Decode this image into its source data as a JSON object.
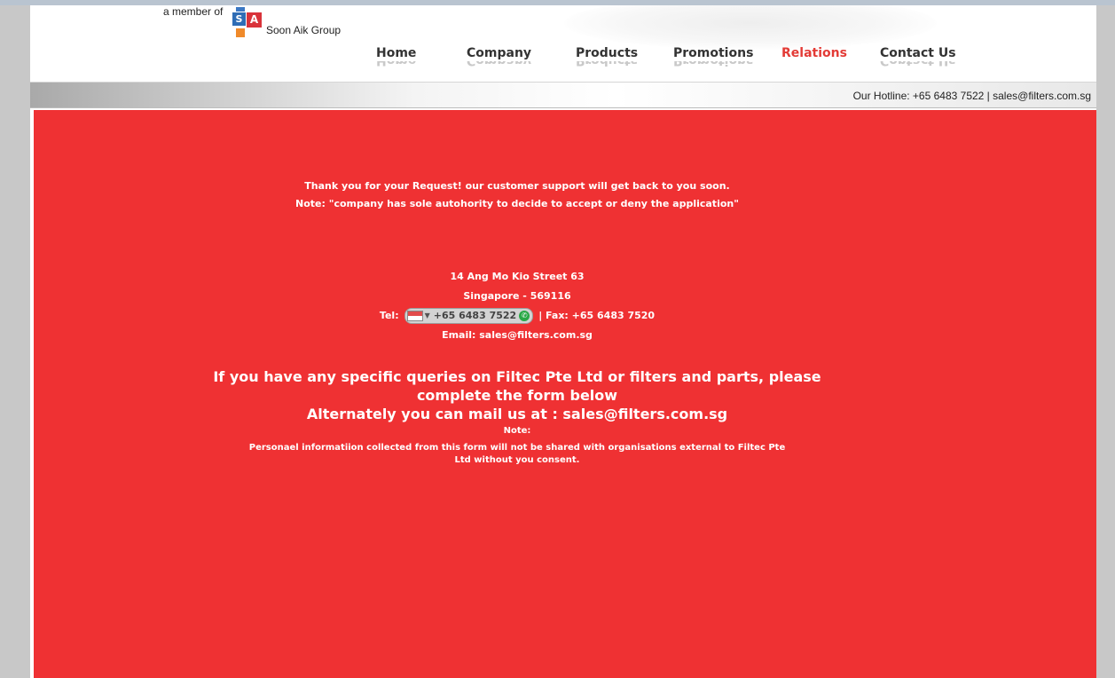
{
  "header": {
    "member_text": "a member of",
    "logo_letters": [
      "S",
      "A"
    ],
    "group_name": "Soon Aik Group"
  },
  "nav": {
    "items": [
      {
        "label": "Home"
      },
      {
        "label": "Company"
      },
      {
        "label": "Products"
      },
      {
        "label": "Promotions"
      },
      {
        "label": "Relations",
        "active": true
      },
      {
        "label": "Contact Us"
      }
    ]
  },
  "hotline": {
    "text": "Our Hotline: +65 6483 7522 | sales@filters.com.sg"
  },
  "message": {
    "thanks": "Thank you for your Request!   our customer support will get back to you soon.",
    "note": "Note: \"company has sole autohority to decide to accept or deny the application\""
  },
  "address": {
    "street": "14 Ang Mo Kio Street 63",
    "city": "Singapore - 569116",
    "tel_label": "Tel:",
    "tel_number": "+65 6483 7522",
    "fax_text": "|  Fax: +65 6483 7520",
    "email": "Email: sales@filters.com.sg"
  },
  "queries": {
    "line1": "If you have any specific queries on Filtec Pte Ltd or filters and parts, please",
    "line2": "complete the form below",
    "line3": "Alternately you can mail us at : sales@filters.com.sg",
    "note_label": "Note:",
    "privacy1": "Personael informatiion collected from this form will not be shared with organisations external to Filtec Pte",
    "privacy2": "Ltd without you consent."
  },
  "colors": {
    "content_bg": "#ef3133",
    "active_nav": "#e33b36"
  }
}
